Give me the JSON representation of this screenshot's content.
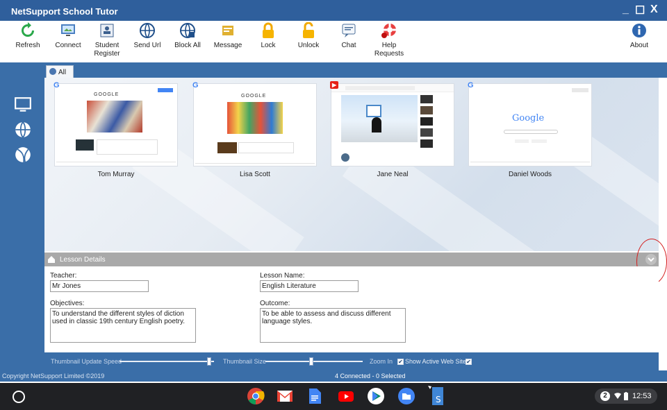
{
  "window": {
    "title": "NetSupport School Tutor",
    "minimize": "_",
    "maximize": "☐",
    "close": "X"
  },
  "toolbar": {
    "refresh": "Refresh",
    "connect": "Connect",
    "student_register": [
      "Student",
      "Register"
    ],
    "send_url": "Send Url",
    "block_all": "Block All",
    "message": "Message",
    "lock": "Lock",
    "unlock": "Unlock",
    "chat": "Chat",
    "help_requests": [
      "Help",
      "Requests"
    ],
    "about": "About"
  },
  "tabs": {
    "all": "All"
  },
  "students": [
    {
      "name": "Tom Murray",
      "site_icon": "G"
    },
    {
      "name": "Lisa Scott",
      "site_icon": "G"
    },
    {
      "name": "Jane Neal",
      "site_icon": "▶"
    },
    {
      "name": "Daniel Woods",
      "site_icon": "G"
    }
  ],
  "thumb_text": {
    "google_logo": "Google",
    "doodle_text": "GOOGLE"
  },
  "lesson": {
    "header": "Lesson Details",
    "teacher_label": "Teacher:",
    "teacher_value": "Mr Jones",
    "lesson_name_label": "Lesson Name:",
    "lesson_name_value": "English Literature",
    "objectives_label": "Objectives:",
    "objectives_value": "To understand the different styles of diction used in classic 19th century English poetry.",
    "outcome_label": "Outcome:",
    "outcome_value": "To be able to assess and discuss different language styles."
  },
  "zoom": {
    "update_speed_label": "Thumbnail Update Speed",
    "size_label": "Thumbnail Size",
    "zoom_in_label": "Zoom In",
    "show_active_label": "Show Active Web Site",
    "zoom_in_checked": true,
    "show_active_checked": true,
    "update_speed_level": 0.95,
    "size_level": 0.47
  },
  "status": {
    "copyright": "Copyright NetSupport Limited ©2019",
    "connection": "4 Connected - 0 Selected"
  },
  "shelf": {
    "apps": [
      "chrome-icon",
      "gmail-icon",
      "docs-icon",
      "youtube-icon",
      "play-store-icon",
      "files-icon",
      "netsupport-student-icon"
    ],
    "notifications": "2",
    "time": "12:53"
  },
  "colors": {
    "title_bar": "#2f5f9c",
    "panel_blue": "#3a6ea8",
    "lesson_header": "#a9a9a9",
    "annotation_red": "#d42020"
  }
}
